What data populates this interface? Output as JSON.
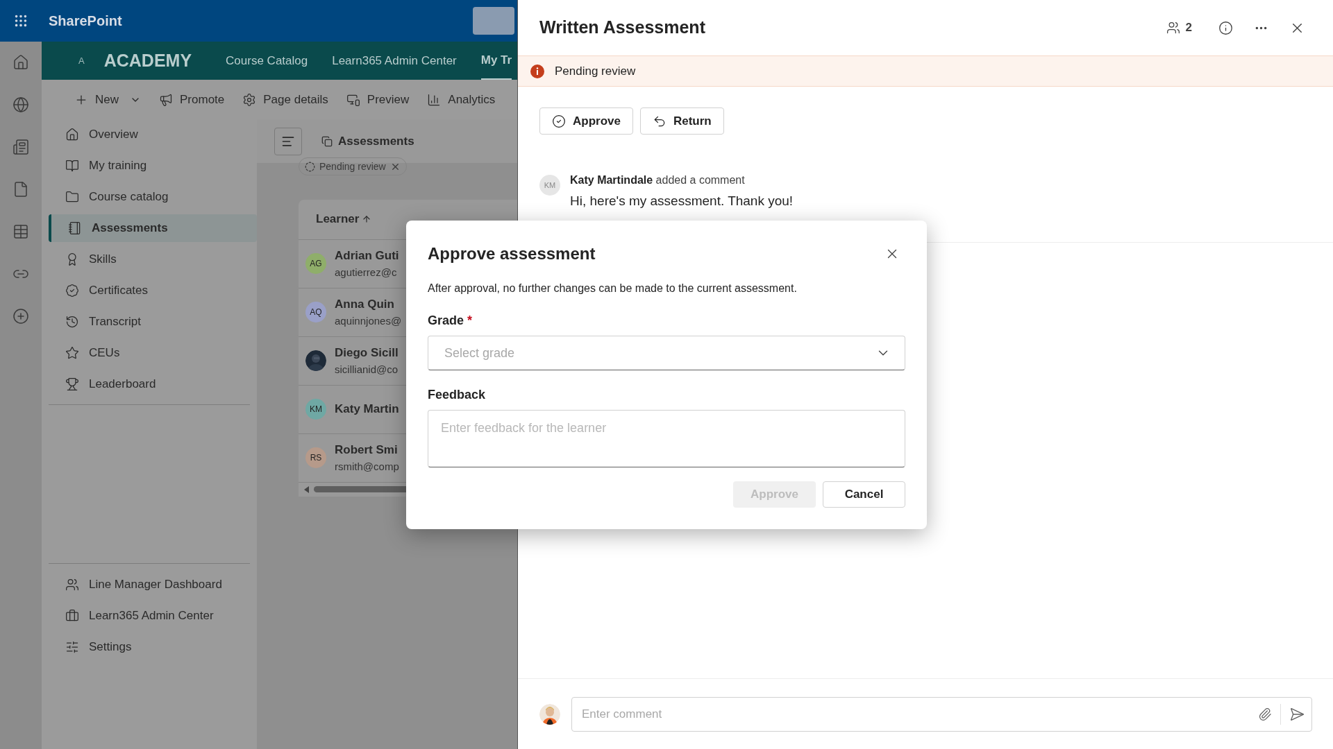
{
  "suite_bar": {
    "title": "SharePoint"
  },
  "site_header": {
    "logo": "A",
    "title": "ACADEMY",
    "nav": [
      {
        "label": "Course Catalog",
        "selected": false
      },
      {
        "label": "Learn365 Admin Center",
        "selected": false
      },
      {
        "label": "My Tr",
        "selected": true
      }
    ]
  },
  "command_bar": [
    {
      "label": "New",
      "dropdown": true
    },
    {
      "label": "Promote",
      "dropdown": false
    },
    {
      "label": "Page details",
      "dropdown": false
    },
    {
      "label": "Preview",
      "dropdown": false
    },
    {
      "label": "Analytics",
      "dropdown": false
    }
  ],
  "sidebar": {
    "items": [
      {
        "label": "Overview",
        "selected": false
      },
      {
        "label": "My training",
        "selected": false
      },
      {
        "label": "Course catalog",
        "selected": false
      },
      {
        "label": "Assessments",
        "selected": true
      },
      {
        "label": "Skills",
        "selected": false
      },
      {
        "label": "Certificates",
        "selected": false
      },
      {
        "label": "Transcript",
        "selected": false
      },
      {
        "label": "CEUs",
        "selected": false
      },
      {
        "label": "Leaderboard",
        "selected": false
      }
    ],
    "footer_items": [
      {
        "label": "Line Manager Dashboard"
      },
      {
        "label": "Learn365 Admin Center"
      },
      {
        "label": "Settings"
      }
    ]
  },
  "content": {
    "title": "Assessments",
    "filter_chip": "Pending review",
    "table": {
      "columns": [
        "Learner"
      ],
      "rows": [
        {
          "avatar": {
            "kind": "initials",
            "text": "AG",
            "color": "#8fae6a"
          },
          "name": "Adrian Guti",
          "email": "agutierrez@c"
        },
        {
          "avatar": {
            "kind": "initials",
            "text": "AQ",
            "color": "#9aa0c8"
          },
          "name": "Anna Quin",
          "email": "aquinnjones@"
        },
        {
          "name": "Diego Sicill",
          "email": "sicillianid@co"
        },
        {
          "avatar": {
            "kind": "initials",
            "text": "KM",
            "color": "#6fa8a4"
          },
          "name": "Katy Martin"
        },
        {
          "avatar": {
            "kind": "initials",
            "text": "RS",
            "color": "#b69a8a"
          },
          "name": "Robert Smi",
          "email": "rsmith@comp"
        }
      ]
    }
  },
  "panel": {
    "title": "Written Assessment",
    "participants": "2",
    "status": "Pending review",
    "actions": [
      "Approve",
      "Return"
    ],
    "comment": {
      "avatar": "KM",
      "author": "Katy Martindale",
      "action": "added a comment",
      "text": "Hi, here's my assessment. Thank you!"
    },
    "comment_box": {
      "placeholder": "Enter comment"
    }
  },
  "dialog": {
    "title": "Approve assessment",
    "description": "After approval, no further changes can be made to the current assessment.",
    "grade": {
      "label": "Grade",
      "required_mark": "*",
      "placeholder": "Select grade"
    },
    "feedback": {
      "label": "Feedback",
      "placeholder": "Enter feedback for the learner"
    },
    "buttons": [
      {
        "label": "Approve",
        "kind": "primary",
        "disabled": true
      },
      {
        "label": "Cancel",
        "kind": "secondary",
        "disabled": false
      }
    ]
  }
}
